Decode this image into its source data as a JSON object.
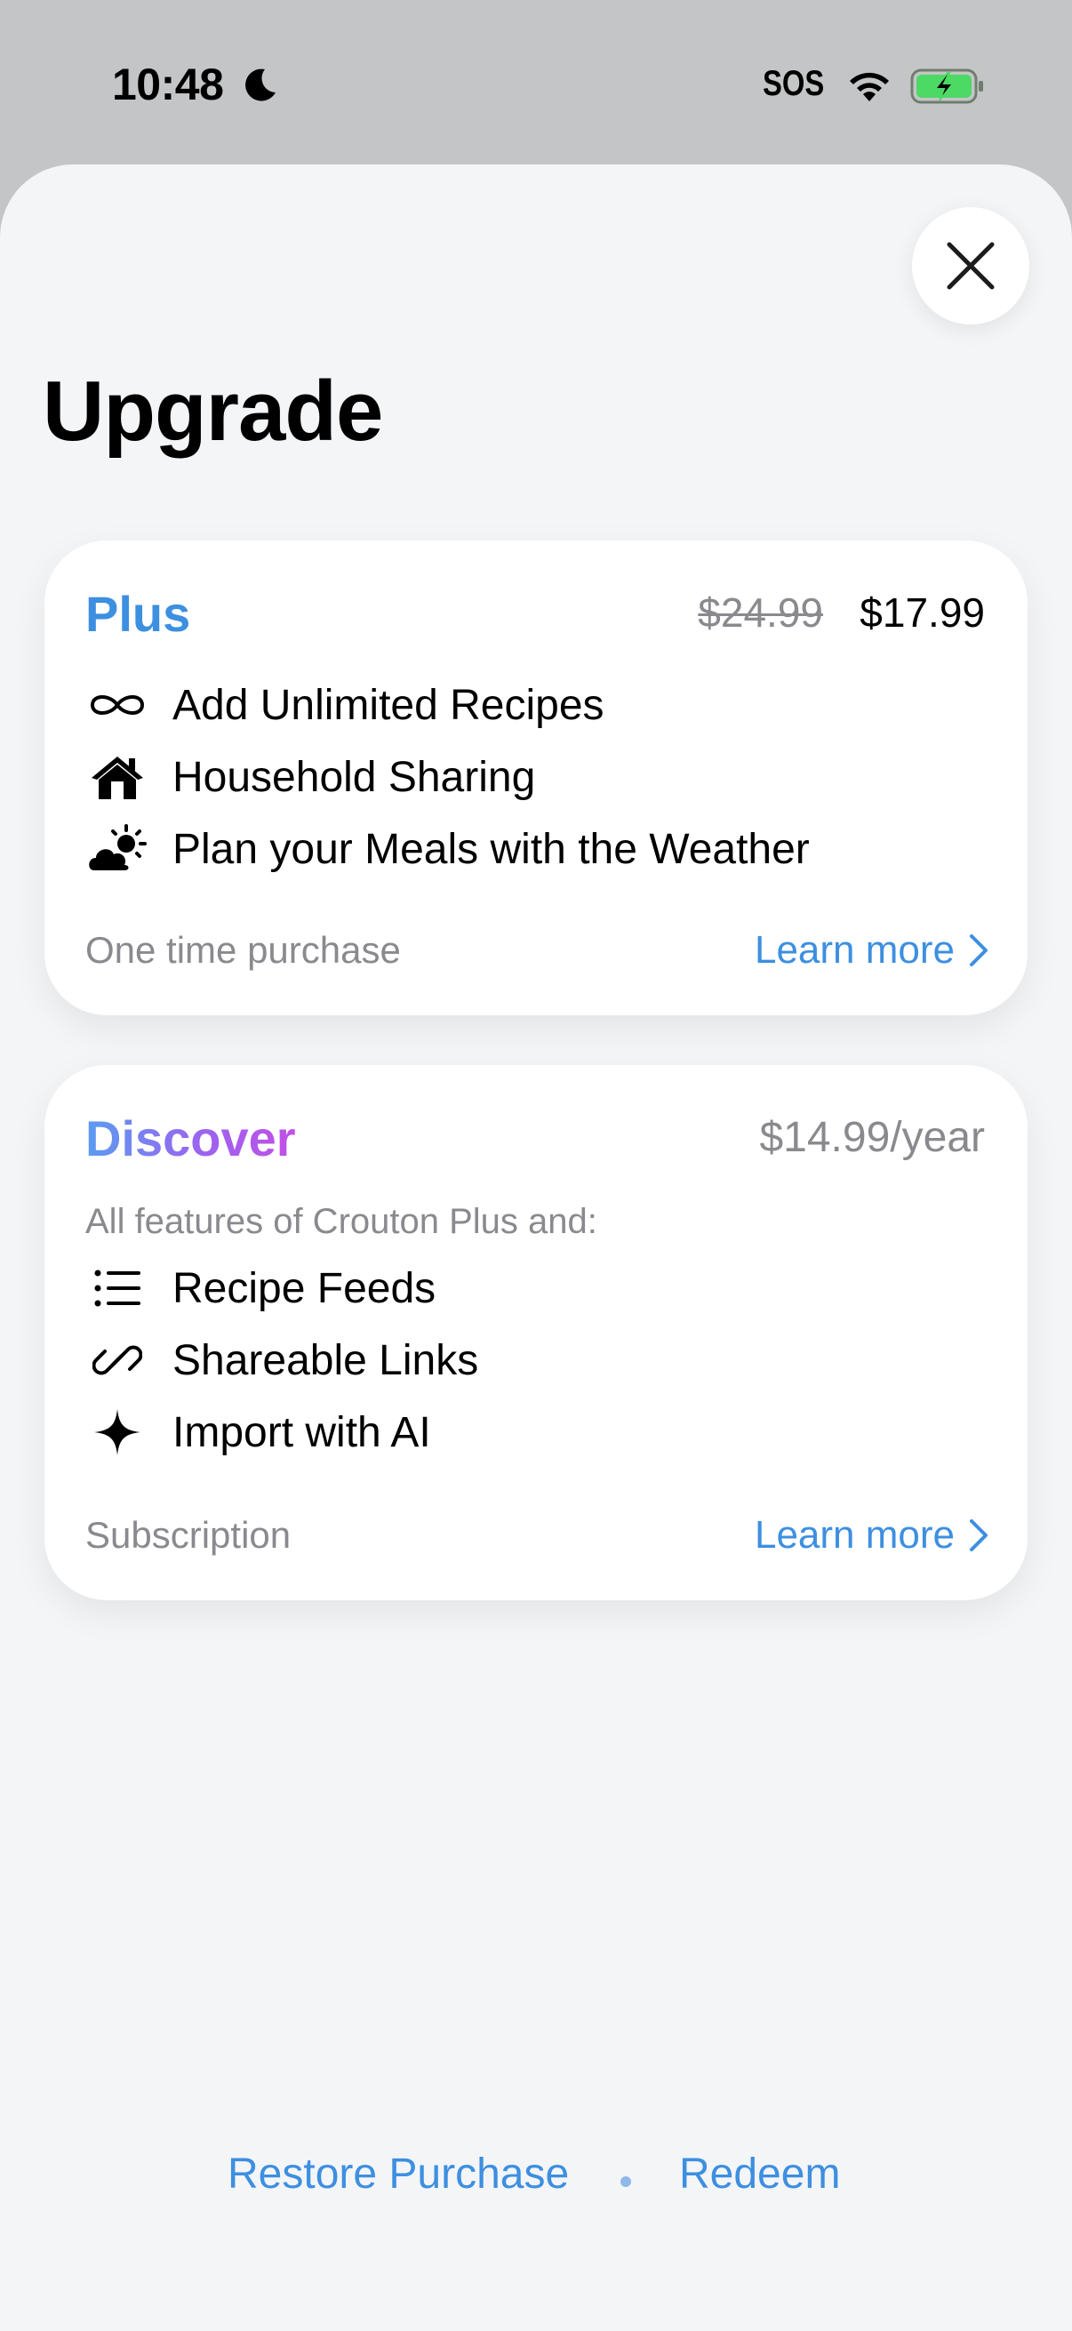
{
  "status_bar": {
    "time": "10:48",
    "sos": "SOS",
    "icons": [
      "moon-icon",
      "wifi-icon",
      "battery-charging-icon"
    ],
    "battery_color": "#4cd964"
  },
  "header": {
    "title": "Upgrade",
    "close_icon": "close-icon"
  },
  "plans": [
    {
      "name": "Plus",
      "price_original": "$24.99",
      "price_current": "$17.99",
      "features": [
        {
          "icon": "infinity-icon",
          "label": "Add Unlimited Recipes"
        },
        {
          "icon": "house-icon",
          "label": "Household Sharing"
        },
        {
          "icon": "cloud-sun-icon",
          "label": "Plan your Meals with the Weather"
        }
      ],
      "type_label": "One time purchase",
      "learn_more": "Learn more"
    },
    {
      "name": "Discover",
      "price": "$14.99/year",
      "intro": "All features of Crouton Plus and:",
      "features": [
        {
          "icon": "list-icon",
          "label": "Recipe Feeds"
        },
        {
          "icon": "link-icon",
          "label": "Shareable Links"
        },
        {
          "icon": "sparkle-icon",
          "label": "Import with AI"
        }
      ],
      "type_label": "Subscription",
      "learn_more": "Learn more"
    }
  ],
  "footer": {
    "restore": "Restore Purchase",
    "redeem": "Redeem"
  },
  "colors": {
    "accent": "#3d8fe0",
    "secondary_text": "#8a8a8e",
    "sheet_background": "#f4f5f7",
    "discover_gradient": [
      "#5b9cf0",
      "#9b64f0",
      "#c24fe6"
    ]
  }
}
